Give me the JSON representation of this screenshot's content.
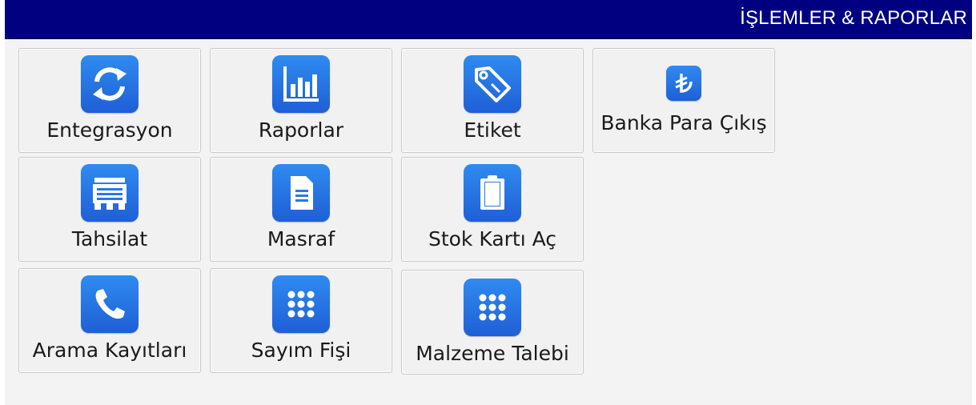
{
  "header": {
    "title": "İŞLEMLER & RAPORLAR"
  },
  "tiles": [
    {
      "label": "Entegrasyon",
      "icon": "refresh-icon"
    },
    {
      "label": "Raporlar",
      "icon": "bar-chart-icon"
    },
    {
      "label": "Etiket",
      "icon": "tag-icon"
    },
    {
      "label": "Banka Para Çıkış",
      "icon": "lira-icon"
    },
    {
      "label": "Tahsilat",
      "icon": "cash-register-icon"
    },
    {
      "label": "Masraf",
      "icon": "document-icon"
    },
    {
      "label": "Stok Kartı Aç",
      "icon": "clipboard-icon"
    },
    {
      "label": "Arama Kayıtları",
      "icon": "phone-icon"
    },
    {
      "label": "Sayım Fişi",
      "icon": "keypad-icon"
    },
    {
      "label": "Malzeme Talebi",
      "icon": "keypad-icon"
    }
  ]
}
